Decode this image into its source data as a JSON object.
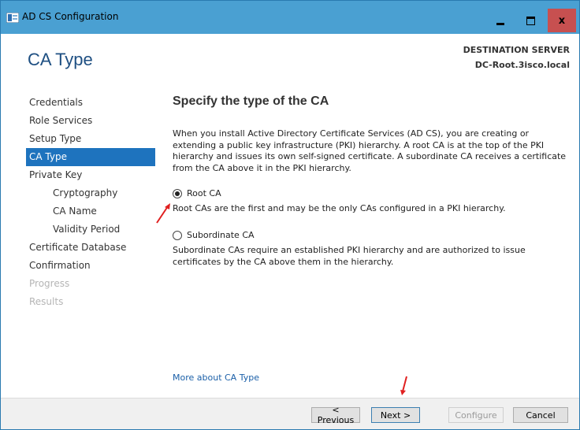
{
  "window": {
    "title": "AD CS Configuration"
  },
  "header": {
    "page_title": "CA Type",
    "destination_label": "DESTINATION SERVER",
    "destination_server": "DC-Root.3isco.local"
  },
  "nav": {
    "items": [
      {
        "label": "Credentials",
        "state": "normal"
      },
      {
        "label": "Role Services",
        "state": "normal"
      },
      {
        "label": "Setup Type",
        "state": "normal"
      },
      {
        "label": "CA Type",
        "state": "active"
      },
      {
        "label": "Private Key",
        "state": "normal"
      },
      {
        "label": "Cryptography",
        "state": "sub"
      },
      {
        "label": "CA Name",
        "state": "sub"
      },
      {
        "label": "Validity Period",
        "state": "sub"
      },
      {
        "label": "Certificate Database",
        "state": "normal"
      },
      {
        "label": "Confirmation",
        "state": "normal"
      },
      {
        "label": "Progress",
        "state": "disabled"
      },
      {
        "label": "Results",
        "state": "disabled"
      }
    ]
  },
  "main": {
    "heading": "Specify the type of the CA",
    "description": "When you install Active Directory Certificate Services (AD CS), you are creating or extending a public key infrastructure (PKI) hierarchy. A root CA is at the top of the PKI hierarchy and issues its own self-signed certificate. A subordinate CA receives a certificate from the CA above it in the PKI hierarchy.",
    "options": [
      {
        "label": "Root CA",
        "selected": true,
        "description": "Root CAs are the first and may be the only CAs configured in a PKI hierarchy."
      },
      {
        "label": "Subordinate CA",
        "selected": false,
        "description": "Subordinate CAs require an established PKI hierarchy and are authorized to issue certificates by the CA above them in the hierarchy."
      }
    ],
    "more_link": "More about CA Type"
  },
  "footer": {
    "previous": "< Previous",
    "next": "Next >",
    "configure": "Configure",
    "cancel": "Cancel"
  },
  "colors": {
    "titlebar": "#4aa0d2",
    "accent": "#1e73be",
    "close": "#c75050",
    "annotation_arrow": "#e02020"
  }
}
